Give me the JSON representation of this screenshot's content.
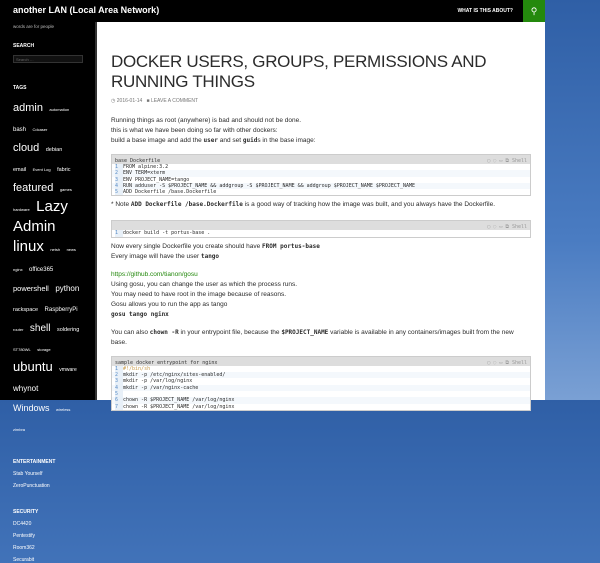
{
  "header": {
    "site_title": "another LAN (Local Area Network)",
    "nav_about": "WHAT IS THIS ABOUT?",
    "search_icon": "search-icon"
  },
  "sidebar": {
    "tagline": "words are for people",
    "search_title": "SEARCH",
    "search_placeholder": "Search …",
    "tags_title": "TAGS",
    "tags": [
      [
        "admin",
        11
      ],
      [
        "automation",
        4
      ],
      [
        "bash",
        6
      ],
      [
        "Cdcaser",
        4
      ],
      [
        "cloud",
        11
      ],
      [
        "debian",
        5.5
      ],
      [
        "email",
        5.5
      ],
      [
        "Event Log",
        4
      ],
      [
        "fabric",
        5.5
      ],
      [
        "featured",
        11
      ],
      [
        "games",
        4
      ],
      [
        "hardware",
        4
      ],
      [
        "Lazy",
        15
      ],
      [
        "Admin",
        15
      ],
      [
        "linux",
        15
      ],
      [
        "netsh",
        4
      ],
      [
        "news",
        4
      ],
      [
        "nginx",
        4
      ],
      [
        "office365",
        6
      ],
      [
        "powershell",
        7.5
      ],
      [
        "python",
        8
      ],
      [
        "rackspace",
        5.5
      ],
      [
        "RaspberryPi",
        6
      ],
      [
        "router",
        4
      ],
      [
        "shell",
        10
      ],
      [
        "soldering",
        5.5
      ],
      [
        "ST780WL",
        4
      ],
      [
        "storage",
        4
      ],
      [
        "ubuntu",
        13
      ],
      [
        "vmware",
        5
      ],
      [
        "whynot",
        8
      ],
      [
        "Windows",
        9
      ],
      [
        "wireless",
        4
      ],
      [
        "zimbra",
        4
      ]
    ],
    "entertainment_title": "ENTERTAINMENT",
    "entertainment": [
      "Stab Yourself",
      "ZeroPunctuation"
    ],
    "security_title": "SECURITY",
    "security": [
      "DC4420",
      "Pentestify",
      "Room362",
      "Securabit"
    ]
  },
  "post": {
    "title": "DOCKER USERS, GROUPS, PERMISSIONS AND RUNNING THINGS",
    "date": "2016-01-14",
    "comment": "LEAVE A COMMENT",
    "p1": [
      "Running things as root (anywhere) is bad and should not be done.",
      "this is what we have been doing so far with other dockers:"
    ],
    "p1c": {
      "a": "build a base image and add the ",
      "b": "user",
      "c": " and set ",
      "d": "guid",
      "e": "s in the base image:"
    },
    "code1": {
      "title": "base Dockerfile",
      "lang": "Shell",
      "lines": [
        "FROM alpine:3.2",
        "ENV TERM=xterm",
        "ENV PROJECT_NAME=tango",
        "RUN adduser -S $PROJECT_NAME && addgroup -S $PROJECT_NAME && addgroup $PROJECT_NAME $PROJECT_NAME",
        "ADD Dockerfile /base.Dockerfile"
      ]
    },
    "note": {
      "a": "* Note ",
      "b": "ADD Dockerfile /base.Dockerfile",
      "c": " is a good way of tracking how the image was built, and you always have the Dockerfile."
    },
    "code2": {
      "lang": "Shell",
      "lines": [
        "docker build -t portus-base ."
      ]
    },
    "p2": {
      "a": "Now every single Dockerfile you create should have ",
      "b": "FROM portus-base",
      "c": "Every image will have the user ",
      "d": "tango"
    },
    "link": "https://github.com/tianon/gosu",
    "p3": [
      "Using gosu, you can change the user as which the process runs.",
      "You may need to have root in the image because of reasons.",
      "Gosu allows you to run the app as tango"
    ],
    "p3code": "gosu tango nginx",
    "p4": {
      "a": "You can also ",
      "b": "chown -R",
      "c": " in your entrypoint file, because the ",
      "d": "$PROJECT_NAME",
      "e": " variable is available in any containers/images built from the new base."
    },
    "code3": {
      "title": "sample docker entrypoint for nginx",
      "lang": "Shell",
      "lines": [
        "#!/bin/sh",
        "mkdir -p /etc/nginx/sites-enabled/",
        "mkdir -p /var/log/nginx",
        "mkdir -p /var/nginx-cache",
        "",
        "chown -R $PROJECT_NAME /var/log/nginx",
        "chown -R $PROJECT_NAME /var/log/nginx"
      ]
    }
  }
}
